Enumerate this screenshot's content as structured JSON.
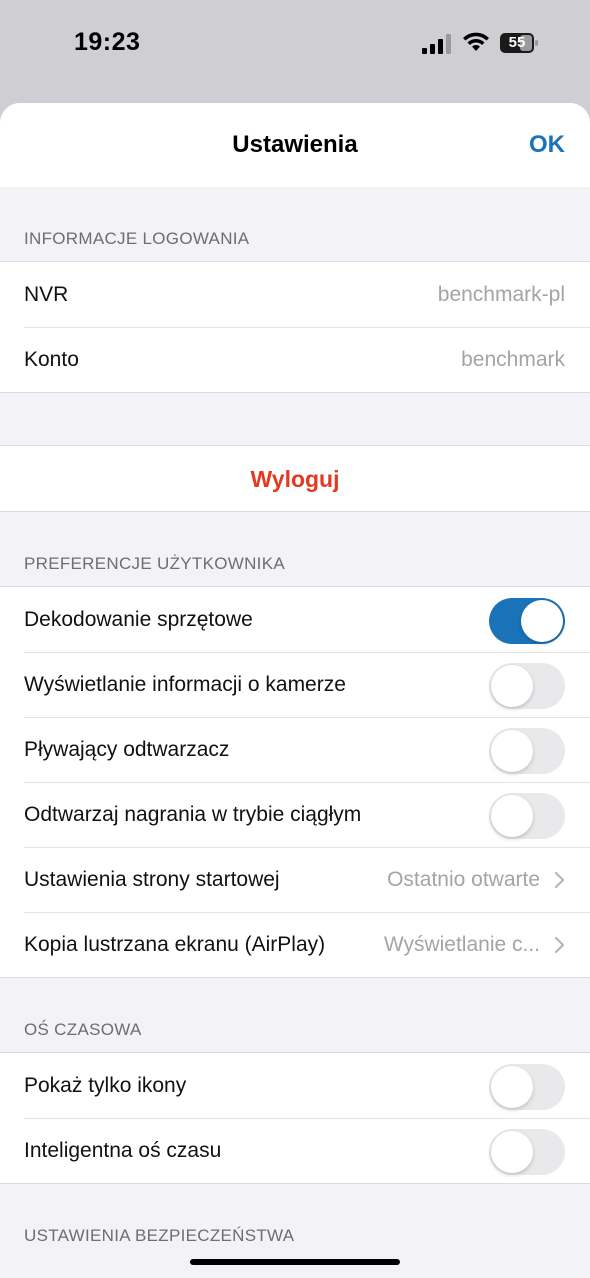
{
  "status_bar": {
    "time": "19:23",
    "battery_level": "55"
  },
  "nav": {
    "title": "Ustawienia",
    "ok_label": "OK"
  },
  "login_info": {
    "header": "INFORMACJE LOGOWANIA",
    "rows": [
      {
        "label": "NVR",
        "value": "benchmark-pl"
      },
      {
        "label": "Konto",
        "value": "benchmark"
      }
    ]
  },
  "logout": {
    "label": "Wyloguj"
  },
  "user_preferences": {
    "header": "PREFERENCJE UŻYTKOWNIKA",
    "toggles": [
      {
        "label": "Dekodowanie sprzętowe",
        "on": true
      },
      {
        "label": "Wyświetlanie informacji o kamerze",
        "on": false
      },
      {
        "label": "Pływający odtwarzacz",
        "on": false
      },
      {
        "label": "Odtwarzaj nagrania w trybie ciągłym",
        "on": false
      }
    ],
    "links": [
      {
        "label": "Ustawienia strony startowej",
        "value": "Ostatnio otwarte"
      },
      {
        "label": "Kopia lustrzana ekranu (AirPlay)",
        "value": "Wyświetlanie c..."
      }
    ]
  },
  "timeline": {
    "header": "OŚ CZASOWA",
    "toggles": [
      {
        "label": "Pokaż tylko ikony",
        "on": false
      },
      {
        "label": "Inteligentna oś czasu",
        "on": false
      }
    ]
  },
  "security": {
    "header": "USTAWIENIA BEZPIECZEŃSTWA"
  },
  "colors": {
    "accent": "#1a73b8",
    "destructive": "#e5391f",
    "background": "#f2f2f7"
  }
}
